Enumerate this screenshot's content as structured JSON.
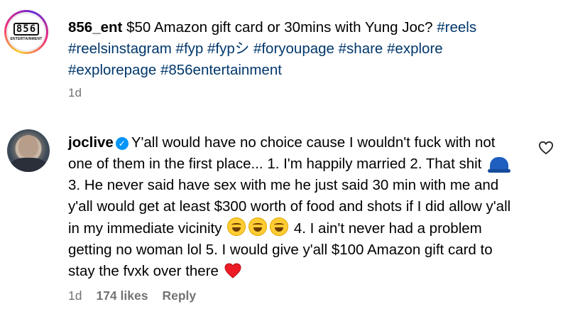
{
  "caption": {
    "username": "856_ent",
    "text": "$50 Amazon gift card or 30mins with Yung Joc?",
    "hashtags": [
      "#reels",
      "#reelsinstagram",
      "#fyp",
      "#fypシ",
      "#foryoupage",
      "#share",
      "#explore",
      "#explorepage",
      "#856entertainment"
    ],
    "time": "1d",
    "logo_number": "856",
    "logo_subtext": "ENTERTAINMENT"
  },
  "comment": {
    "username": "joclive",
    "verified_glyph": "✓",
    "text_part1": "Y'all would have no choice cause I wouldn't fuck with not one of them in the first place... 1. I'm happily married 2. That shit",
    "text_part2": "3. He never said have sex with me he just said 30 min with me and y'all would get at least $300 worth of food and shots if I did allow y'all in my immediate vicinity",
    "text_part3": "4. I ain't never had a problem getting no woman lol 5. I would give y'all $100 Amazon gift card to stay the fvxk over there",
    "time": "1d",
    "likes": "174 likes",
    "reply_label": "Reply",
    "emojis": [
      "blue-cap-emoji",
      "laughing-emoji",
      "laughing-emoji",
      "laughing-emoji",
      "red-heart-emoji"
    ]
  },
  "colors": {
    "hashtag": "#00376b",
    "meta": "#737373",
    "verified": "#0095f6",
    "heart": "#ed1c24"
  }
}
